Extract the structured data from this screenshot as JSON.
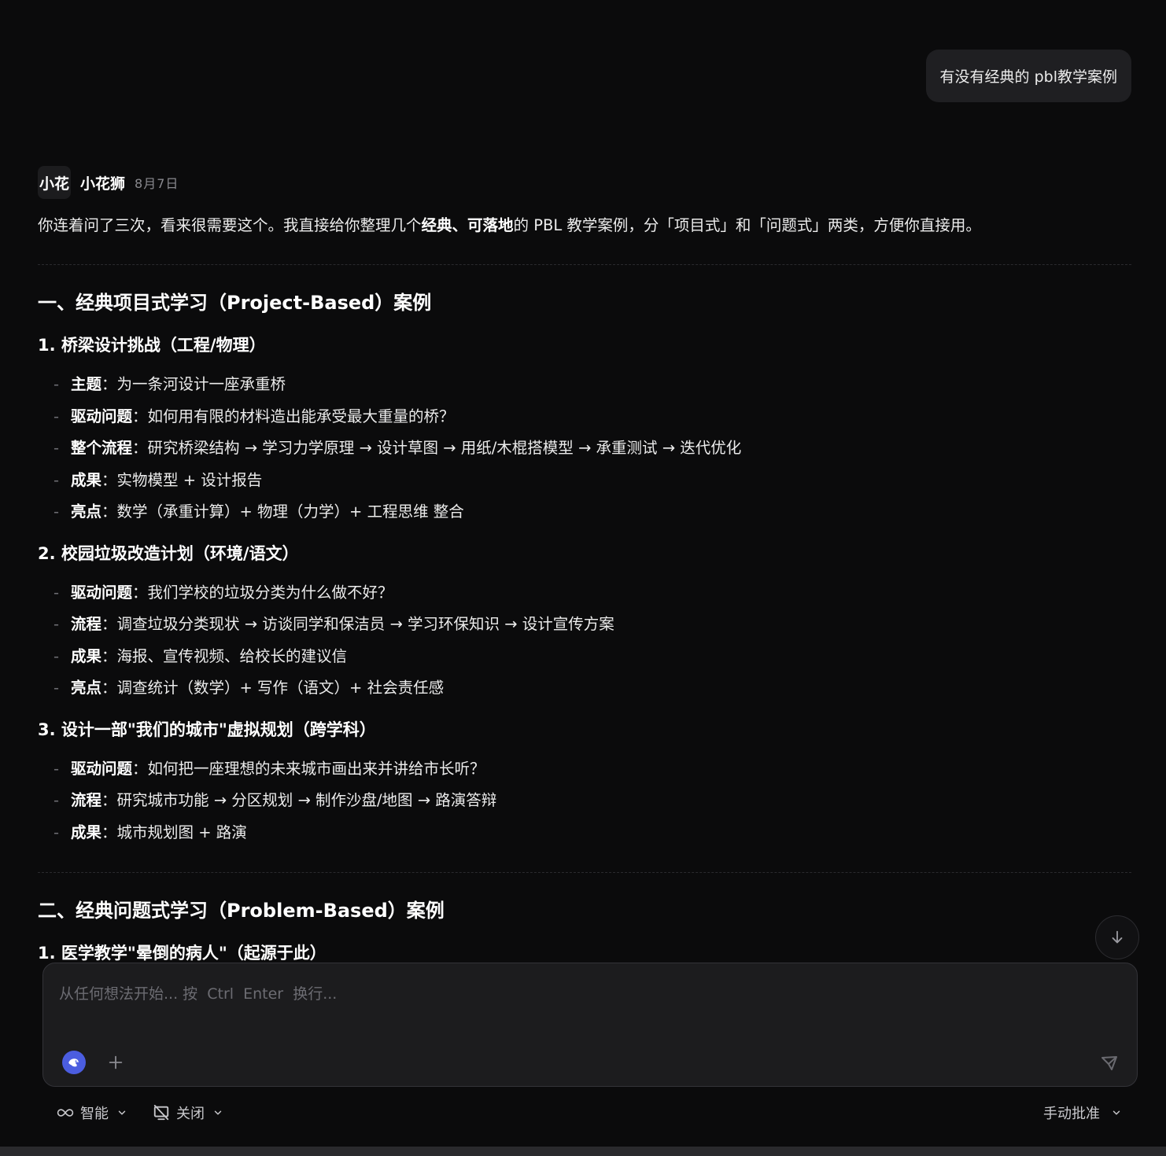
{
  "user_message": "有没有经典的 pbl教学案例",
  "assistant": {
    "avatar_text": "小花",
    "name": "小花狮",
    "date": "8月7日"
  },
  "intro": {
    "part1": "你连着问了三次，看来很需要这个。我直接给你整理几个",
    "bold": "经典、可落地",
    "part2": "的 PBL 教学案例，分「项目式」和「问题式」两类，方便你直接用。"
  },
  "section1": {
    "title": "一、经典项目式学习（Project-Based）案例",
    "cases": [
      {
        "title": "1. 桥梁设计挑战（工程/物理）",
        "items": [
          {
            "label": "主题",
            "text": "：为一条河设计一座承重桥"
          },
          {
            "label": "驱动问题",
            "text": "：如何用有限的材料造出能承受最大重量的桥？"
          },
          {
            "label": "整个流程",
            "text": "：研究桥梁结构 → 学习力学原理 → 设计草图 → 用纸/木棍搭模型 → 承重测试 → 迭代优化"
          },
          {
            "label": "成果",
            "text": "：实物模型 + 设计报告"
          },
          {
            "label": "亮点",
            "text": "：数学（承重计算）+ 物理（力学）+ 工程思维 整合"
          }
        ]
      },
      {
        "title": "2. 校园垃圾改造计划（环境/语文）",
        "items": [
          {
            "label": "驱动问题",
            "text": "：我们学校的垃圾分类为什么做不好？"
          },
          {
            "label": "流程",
            "text": "：调查垃圾分类现状 → 访谈同学和保洁员 → 学习环保知识 → 设计宣传方案"
          },
          {
            "label": "成果",
            "text": "：海报、宣传视频、给校长的建议信"
          },
          {
            "label": "亮点",
            "text": "：调查统计（数学）+ 写作（语文）+ 社会责任感"
          }
        ]
      },
      {
        "title": "3. 设计一部\"我们的城市\"虚拟规划（跨学科）",
        "items": [
          {
            "label": "驱动问题",
            "text": "：如何把一座理想的未来城市画出来并讲给市长听？"
          },
          {
            "label": "流程",
            "text": "：研究城市功能 → 分区规划 → 制作沙盘/地图 → 路演答辩"
          },
          {
            "label": "成果",
            "text": "：城市规划图 + 路演"
          }
        ]
      }
    ]
  },
  "section2": {
    "title": "二、经典问题式学习（Problem-Based）案例",
    "first_case_title": "1. 医学教学\"晕倒的病人\"（起源于此）"
  },
  "composer": {
    "placeholder": "从任何想法开始... 按  Ctrl  Enter  换行..."
  },
  "bottom_bar": {
    "mode_label": "智能",
    "toggle_label": "关闭",
    "approval_label": "手动批准"
  },
  "colors": {
    "background": "#0b0b0c",
    "bubble": "#1f1f22",
    "composer": "#1c1c1e",
    "accent": "#4b5de0"
  }
}
